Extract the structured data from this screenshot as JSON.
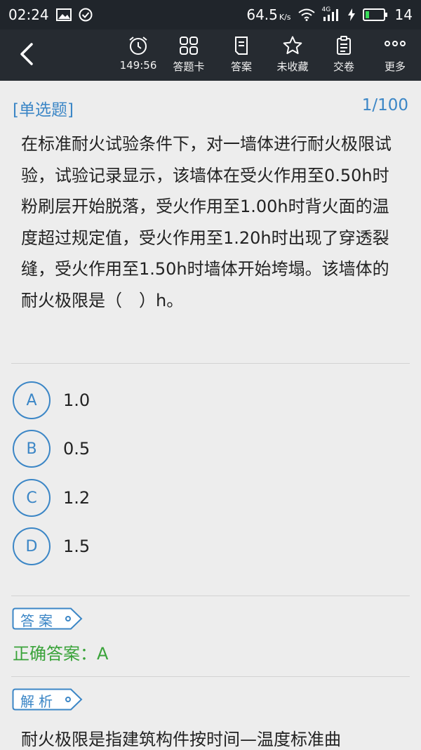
{
  "status_bar": {
    "time": "02:24",
    "speed": "64.5",
    "speed_unit": "K/s",
    "network": "4G",
    "battery": "14"
  },
  "toolbar": {
    "timer": "149:56",
    "answer_card": "答题卡",
    "answer": "答案",
    "favorite": "未收藏",
    "submit": "交卷",
    "more": "更多"
  },
  "question": {
    "type": "[单选题]",
    "progress": "1/100",
    "text": "在标准耐火试验条件下，对一墙体进行耐火极限试验，试验记录显示，该墙体在受火作用至0.50h时粉刷层开始脱落，受火作用至1.00h时背火面的温度超过规定值，受火作用至1.20h时出现了穿透裂缝，受火作用至1.50h时墙体开始垮塌。该墙体的耐火极限是（　）h。"
  },
  "options": [
    {
      "letter": "A",
      "text": "1.0"
    },
    {
      "letter": "B",
      "text": "0.5"
    },
    {
      "letter": "C",
      "text": "1.2"
    },
    {
      "letter": "D",
      "text": "1.5"
    }
  ],
  "answer_section": {
    "tag": "答案",
    "text": "正确答案：A"
  },
  "analysis_section": {
    "tag": "解析",
    "text": "耐火极限是指建筑构件按时间—温度标准曲"
  },
  "colors": {
    "accent": "#3b86c6",
    "correct": "#3aa33a",
    "toolbar_bg": "#262b31",
    "statusbar_bg": "#20252b",
    "page_bg": "#ededed"
  }
}
